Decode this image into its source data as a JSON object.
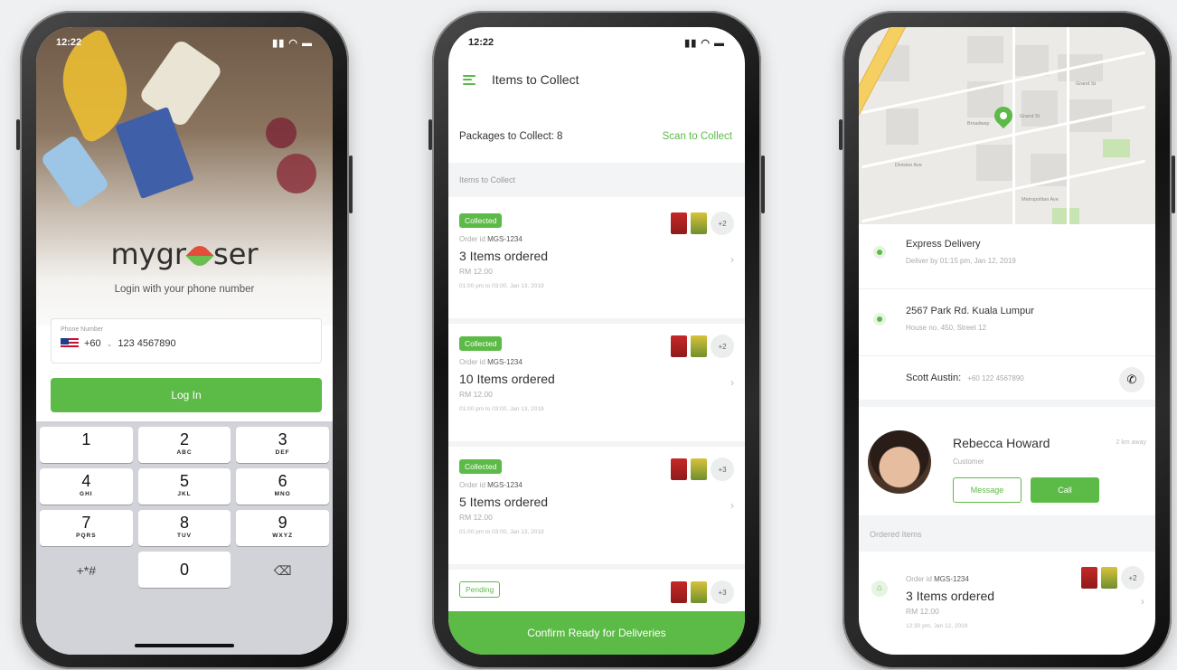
{
  "login": {
    "time": "12:22",
    "logo_left": "mygr",
    "logo_right": "ser",
    "subtitle": "Login with your phone number",
    "phone_label": "Phone Number",
    "country_code": "+60",
    "phone_number": "123 4567890",
    "login_button": "Log In",
    "keypad": [
      {
        "digit": "1",
        "letters": ""
      },
      {
        "digit": "2",
        "letters": "ABC"
      },
      {
        "digit": "3",
        "letters": "DEF"
      },
      {
        "digit": "4",
        "letters": "GHI"
      },
      {
        "digit": "5",
        "letters": "JKL"
      },
      {
        "digit": "6",
        "letters": "MNO"
      },
      {
        "digit": "7",
        "letters": "PQRS"
      },
      {
        "digit": "8",
        "letters": "TUV"
      },
      {
        "digit": "9",
        "letters": "WXYZ"
      }
    ],
    "symbols_key": "+*#",
    "zero_key": "0"
  },
  "collect": {
    "time": "12:22",
    "title": "Items to Collect",
    "packages_label": "Packages to Collect: 8",
    "scan_link": "Scan to Collect",
    "section_label": "Items to Collect",
    "orders": [
      {
        "status": "Collected",
        "order_prefix": "Order id",
        "order_id": "MGS-1234",
        "title": "3 Items ordered",
        "price": "RM 12.00",
        "date": "01:00 pm to 03:00, Jan 13, 2019",
        "more": "+2"
      },
      {
        "status": "Collected",
        "order_prefix": "Order id",
        "order_id": "MGS-1234",
        "title": "10 Items ordered",
        "price": "RM 12.00",
        "date": "01:00 pm to 03:00, Jan 13, 2019",
        "more": "+2"
      },
      {
        "status": "Collected",
        "order_prefix": "Order id",
        "order_id": "MGS-1234",
        "title": "5 Items ordered",
        "price": "RM 12.00",
        "date": "01:00 pm to 03:00, Jan 13, 2019",
        "more": "+3"
      },
      {
        "status": "Pending",
        "more": "+3"
      }
    ],
    "confirm_button": "Confirm Ready for Deliveries"
  },
  "delivery": {
    "map_labels": [
      "Grand St",
      "Broadway",
      "Metropolitan Ave",
      "Division Ave",
      "Grand St"
    ],
    "delivery_type": "Express Delivery",
    "delivery_by": "Deliver by 01:15 pm, Jan 12, 2019",
    "address": "2567 Park Rd. Kuala Lumpur",
    "address_detail": "House no. 450, Street 12",
    "contact_name": "Scott Austin:",
    "contact_phone": "+60 122 4567890",
    "customer_name": "Rebecca Howard",
    "customer_role": "Customer",
    "customer_ago": "2 km away",
    "message_button": "Message",
    "call_button": "Call",
    "ordered_items_label": "Ordered Items",
    "order": {
      "order_prefix": "Order id",
      "order_id": "MGS-1234",
      "title": "3 Items ordered",
      "price": "RM 12.00",
      "date": "12:30 pm, Jan 12, 2019",
      "more": "+2"
    }
  },
  "colors": {
    "accent": "#5cba47"
  }
}
